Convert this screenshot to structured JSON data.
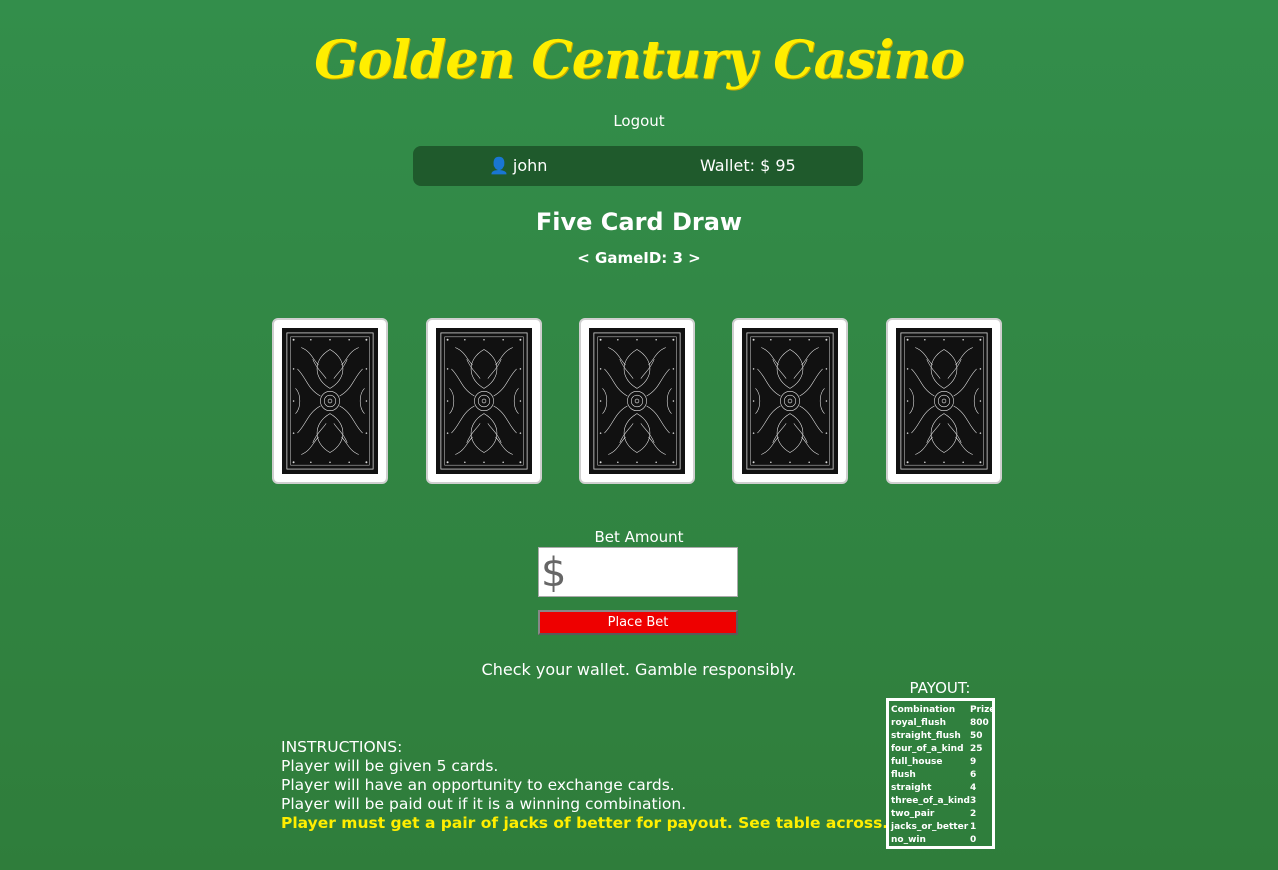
{
  "header": {
    "title": "Golden Century Casino",
    "logout_label": "Logout"
  },
  "userbar": {
    "icon": "user-icon",
    "username": "john",
    "wallet": "Wallet: $ 95"
  },
  "game": {
    "title": "Five Card Draw",
    "game_id": "< GameID: 3 >",
    "cards": [
      {
        "state": "face-down"
      },
      {
        "state": "face-down"
      },
      {
        "state": "face-down"
      },
      {
        "state": "face-down"
      },
      {
        "state": "face-down"
      }
    ]
  },
  "bet": {
    "label": "Bet Amount",
    "currency_symbol": "$",
    "input_value": "",
    "button_label": "Place Bet",
    "button_color": "#ee0000"
  },
  "message": "Check your wallet. Gamble responsibly.",
  "instructions": {
    "heading": "INSTRUCTIONS:",
    "lines": [
      "Player will be given 5 cards.",
      "Player will have an opportunity to exchange cards.",
      "Player will be paid out if it is a winning combination."
    ],
    "highlight": "Player must get a pair of jacks of better for payout. See table across."
  },
  "payout": {
    "label": "PAYOUT:",
    "headers": [
      "Combination",
      "Prize"
    ],
    "rows": [
      [
        "royal_flush",
        "800"
      ],
      [
        "straight_flush",
        "50"
      ],
      [
        "four_of_a_kind",
        "25"
      ],
      [
        "full_house",
        "9"
      ],
      [
        "flush",
        "6"
      ],
      [
        "straight",
        "4"
      ],
      [
        "three_of_a_kind",
        "3"
      ],
      [
        "two_pair",
        "2"
      ],
      [
        "jacks_or_better",
        "1"
      ],
      [
        "no_win",
        "0"
      ]
    ]
  },
  "colors": {
    "background": "#338e4b",
    "title": "#ffee00",
    "userbar": "#1f5a2c",
    "highlight": "#ffee00"
  }
}
